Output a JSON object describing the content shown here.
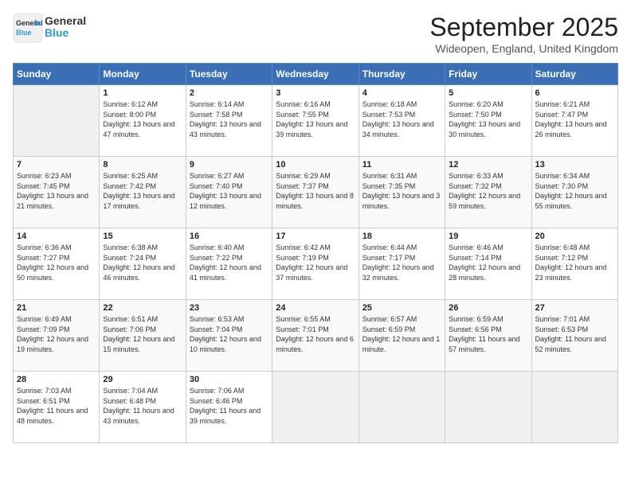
{
  "header": {
    "logo_line1": "General",
    "logo_line2": "Blue",
    "month_title": "September 2025",
    "location": "Wideopen, England, United Kingdom"
  },
  "days_of_week": [
    "Sunday",
    "Monday",
    "Tuesday",
    "Wednesday",
    "Thursday",
    "Friday",
    "Saturday"
  ],
  "weeks": [
    [
      {
        "day": "",
        "sunrise": "",
        "sunset": "",
        "daylight": ""
      },
      {
        "day": "1",
        "sunrise": "Sunrise: 6:12 AM",
        "sunset": "Sunset: 8:00 PM",
        "daylight": "Daylight: 13 hours and 47 minutes."
      },
      {
        "day": "2",
        "sunrise": "Sunrise: 6:14 AM",
        "sunset": "Sunset: 7:58 PM",
        "daylight": "Daylight: 13 hours and 43 minutes."
      },
      {
        "day": "3",
        "sunrise": "Sunrise: 6:16 AM",
        "sunset": "Sunset: 7:55 PM",
        "daylight": "Daylight: 13 hours and 39 minutes."
      },
      {
        "day": "4",
        "sunrise": "Sunrise: 6:18 AM",
        "sunset": "Sunset: 7:53 PM",
        "daylight": "Daylight: 13 hours and 34 minutes."
      },
      {
        "day": "5",
        "sunrise": "Sunrise: 6:20 AM",
        "sunset": "Sunset: 7:50 PM",
        "daylight": "Daylight: 13 hours and 30 minutes."
      },
      {
        "day": "6",
        "sunrise": "Sunrise: 6:21 AM",
        "sunset": "Sunset: 7:47 PM",
        "daylight": "Daylight: 13 hours and 26 minutes."
      }
    ],
    [
      {
        "day": "7",
        "sunrise": "Sunrise: 6:23 AM",
        "sunset": "Sunset: 7:45 PM",
        "daylight": "Daylight: 13 hours and 21 minutes."
      },
      {
        "day": "8",
        "sunrise": "Sunrise: 6:25 AM",
        "sunset": "Sunset: 7:42 PM",
        "daylight": "Daylight: 13 hours and 17 minutes."
      },
      {
        "day": "9",
        "sunrise": "Sunrise: 6:27 AM",
        "sunset": "Sunset: 7:40 PM",
        "daylight": "Daylight: 13 hours and 12 minutes."
      },
      {
        "day": "10",
        "sunrise": "Sunrise: 6:29 AM",
        "sunset": "Sunset: 7:37 PM",
        "daylight": "Daylight: 13 hours and 8 minutes."
      },
      {
        "day": "11",
        "sunrise": "Sunrise: 6:31 AM",
        "sunset": "Sunset: 7:35 PM",
        "daylight": "Daylight: 13 hours and 3 minutes."
      },
      {
        "day": "12",
        "sunrise": "Sunrise: 6:33 AM",
        "sunset": "Sunset: 7:32 PM",
        "daylight": "Daylight: 12 hours and 59 minutes."
      },
      {
        "day": "13",
        "sunrise": "Sunrise: 6:34 AM",
        "sunset": "Sunset: 7:30 PM",
        "daylight": "Daylight: 12 hours and 55 minutes."
      }
    ],
    [
      {
        "day": "14",
        "sunrise": "Sunrise: 6:36 AM",
        "sunset": "Sunset: 7:27 PM",
        "daylight": "Daylight: 12 hours and 50 minutes."
      },
      {
        "day": "15",
        "sunrise": "Sunrise: 6:38 AM",
        "sunset": "Sunset: 7:24 PM",
        "daylight": "Daylight: 12 hours and 46 minutes."
      },
      {
        "day": "16",
        "sunrise": "Sunrise: 6:40 AM",
        "sunset": "Sunset: 7:22 PM",
        "daylight": "Daylight: 12 hours and 41 minutes."
      },
      {
        "day": "17",
        "sunrise": "Sunrise: 6:42 AM",
        "sunset": "Sunset: 7:19 PM",
        "daylight": "Daylight: 12 hours and 37 minutes."
      },
      {
        "day": "18",
        "sunrise": "Sunrise: 6:44 AM",
        "sunset": "Sunset: 7:17 PM",
        "daylight": "Daylight: 12 hours and 32 minutes."
      },
      {
        "day": "19",
        "sunrise": "Sunrise: 6:46 AM",
        "sunset": "Sunset: 7:14 PM",
        "daylight": "Daylight: 12 hours and 28 minutes."
      },
      {
        "day": "20",
        "sunrise": "Sunrise: 6:48 AM",
        "sunset": "Sunset: 7:12 PM",
        "daylight": "Daylight: 12 hours and 23 minutes."
      }
    ],
    [
      {
        "day": "21",
        "sunrise": "Sunrise: 6:49 AM",
        "sunset": "Sunset: 7:09 PM",
        "daylight": "Daylight: 12 hours and 19 minutes."
      },
      {
        "day": "22",
        "sunrise": "Sunrise: 6:51 AM",
        "sunset": "Sunset: 7:06 PM",
        "daylight": "Daylight: 12 hours and 15 minutes."
      },
      {
        "day": "23",
        "sunrise": "Sunrise: 6:53 AM",
        "sunset": "Sunset: 7:04 PM",
        "daylight": "Daylight: 12 hours and 10 minutes."
      },
      {
        "day": "24",
        "sunrise": "Sunrise: 6:55 AM",
        "sunset": "Sunset: 7:01 PM",
        "daylight": "Daylight: 12 hours and 6 minutes."
      },
      {
        "day": "25",
        "sunrise": "Sunrise: 6:57 AM",
        "sunset": "Sunset: 6:59 PM",
        "daylight": "Daylight: 12 hours and 1 minute."
      },
      {
        "day": "26",
        "sunrise": "Sunrise: 6:59 AM",
        "sunset": "Sunset: 6:56 PM",
        "daylight": "Daylight: 11 hours and 57 minutes."
      },
      {
        "day": "27",
        "sunrise": "Sunrise: 7:01 AM",
        "sunset": "Sunset: 6:53 PM",
        "daylight": "Daylight: 11 hours and 52 minutes."
      }
    ],
    [
      {
        "day": "28",
        "sunrise": "Sunrise: 7:03 AM",
        "sunset": "Sunset: 6:51 PM",
        "daylight": "Daylight: 11 hours and 48 minutes."
      },
      {
        "day": "29",
        "sunrise": "Sunrise: 7:04 AM",
        "sunset": "Sunset: 6:48 PM",
        "daylight": "Daylight: 11 hours and 43 minutes."
      },
      {
        "day": "30",
        "sunrise": "Sunrise: 7:06 AM",
        "sunset": "Sunset: 6:46 PM",
        "daylight": "Daylight: 11 hours and 39 minutes."
      },
      {
        "day": "",
        "sunrise": "",
        "sunset": "",
        "daylight": ""
      },
      {
        "day": "",
        "sunrise": "",
        "sunset": "",
        "daylight": ""
      },
      {
        "day": "",
        "sunrise": "",
        "sunset": "",
        "daylight": ""
      },
      {
        "day": "",
        "sunrise": "",
        "sunset": "",
        "daylight": ""
      }
    ]
  ]
}
